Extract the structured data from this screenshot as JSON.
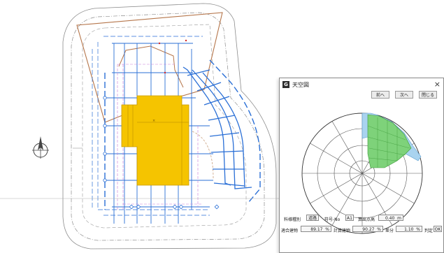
{
  "dialog": {
    "icon_letter": "G",
    "title": "天空図",
    "close_glyph": "×",
    "buttons": {
      "prev": "前へ",
      "next": "次へ",
      "close": "閉じる"
    }
  },
  "fields": {
    "category_label": "料様種別",
    "category_value": "道路",
    "symbol_label": "符号-No",
    "symbol_value": "A1",
    "height_label": "算出点高",
    "height_value": "0.40",
    "height_unit": "m",
    "compliant_label": "適合建物",
    "compliant_value": "89.17",
    "compliant_unit": "%",
    "planned_label": "計算建物",
    "planned_value": "90.27",
    "planned_unit": "%",
    "diff_label": "差分",
    "diff_value": "1.10",
    "diff_unit": "%",
    "judge_label": "判定",
    "judge_value": "OK"
  },
  "colors": {
    "building": "#f5c400",
    "outline": "#b5754a",
    "dim_blue": "#2a6fd6",
    "sky_green": "#7ed27a",
    "sky_blue": "#a9d3ef"
  },
  "icons": [
    "app-icon",
    "close-icon",
    "north-arrow-icon"
  ]
}
